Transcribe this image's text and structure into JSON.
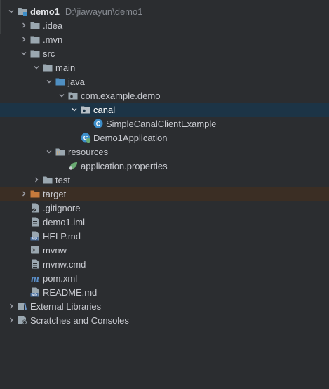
{
  "project": {
    "name": "demo1",
    "path": "D:\\jiawayun\\demo1"
  },
  "tree": {
    "idea": ".idea",
    "mvn": ".mvn",
    "src": "src",
    "main": "main",
    "java": "java",
    "package": "com.example.demo",
    "canal": "canal",
    "simple_canal_client": "SimpleCanalClientExample",
    "demo1_application": "Demo1Application",
    "resources": "resources",
    "application_properties": "application.properties",
    "test": "test",
    "target": "target",
    "gitignore": ".gitignore",
    "demo1_iml": "demo1.iml",
    "help_md": "HELP.md",
    "mvnw": "mvnw",
    "mvnw_cmd": "mvnw.cmd",
    "pom_xml": "pom.xml",
    "readme_md": "README.md",
    "external_libraries": "External Libraries",
    "scratches": "Scratches and Consoles"
  },
  "colors": {
    "background": "#2b2d30",
    "selected_row": "#1c3446",
    "excluded_row": "#3b2e24",
    "folder": "#9aa7b0",
    "source_folder": "#4f8fc2",
    "excluded_folder": "#c67a3c",
    "class_icon": "#3d8ec9",
    "spring_green": "#6aab73"
  }
}
